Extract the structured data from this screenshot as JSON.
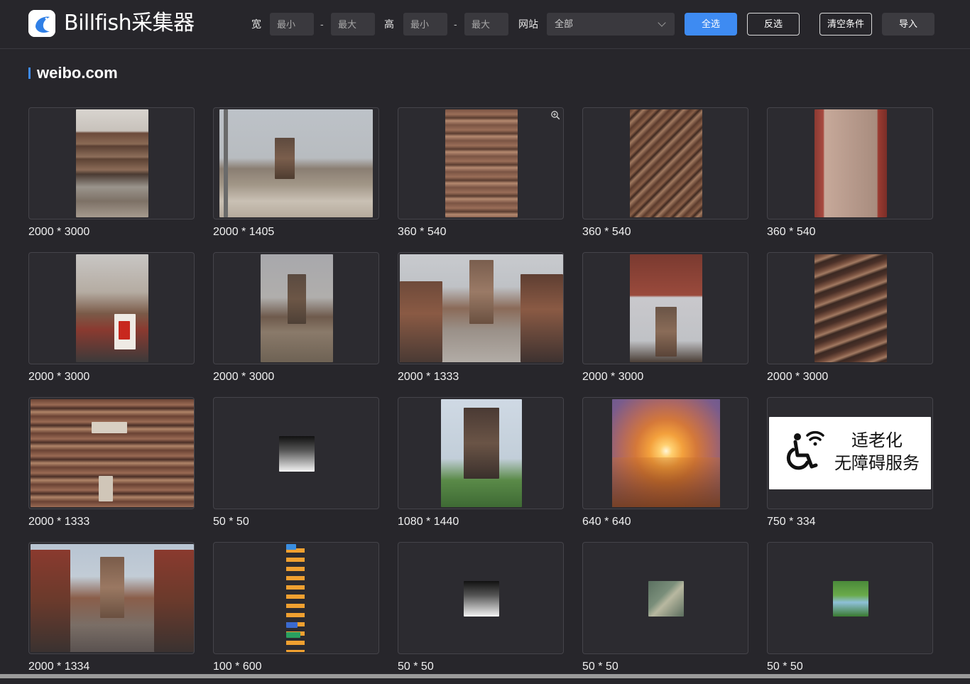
{
  "app": {
    "title": "Billfish采集器"
  },
  "filters": {
    "width_label": "宽",
    "height_label": "高",
    "site_label": "网站",
    "dash": "-",
    "min_placeholder": "最小",
    "max_placeholder": "最大",
    "site_value": "全部"
  },
  "buttons": {
    "select_all": "全选",
    "invert": "反选",
    "clear": "清空条件",
    "import": "导入"
  },
  "section": {
    "title": "weibo.com"
  },
  "icons": {
    "logo": "billfish-fish-icon",
    "zoom": "zoom-in-icon",
    "dropdown": "chevron-down-icon"
  },
  "accent_color": "#3e8bf2",
  "images": [
    {
      "dims": "2000 * 3000",
      "desc": "pagoda-ruins-portrait"
    },
    {
      "dims": "2000 * 1405",
      "desc": "pagoda-power-lines-landscape"
    },
    {
      "dims": "360 * 540",
      "desc": "pagoda-eaves-portrait"
    },
    {
      "dims": "360 * 540",
      "desc": "bracket-detail-portrait"
    },
    {
      "dims": "360 * 540",
      "desc": "mural-doorway-portrait"
    },
    {
      "dims": "2000 * 3000",
      "desc": "street-vendor-pagoda"
    },
    {
      "dims": "2000 * 3000",
      "desc": "dirt-road-pagoda"
    },
    {
      "dims": "2000 * 1333",
      "desc": "old-street-pagoda-landscape"
    },
    {
      "dims": "2000 * 3000",
      "desc": "gate-framed-pagoda"
    },
    {
      "dims": "2000 * 3000",
      "desc": "pagoda-tiers-detail"
    },
    {
      "dims": "2000 * 1333",
      "desc": "pagoda-plaques-landscape"
    },
    {
      "dims": "50 * 50",
      "desc": "tiny-gradient-icon"
    },
    {
      "dims": "1080 * 1440",
      "desc": "pagoda-trees-sky"
    },
    {
      "dims": "640 * 640",
      "desc": "sunrise-clouds"
    },
    {
      "dims": "750 * 334",
      "desc": "accessibility-banner"
    },
    {
      "dims": "2000 * 1334",
      "desc": "crowded-street-pagoda"
    },
    {
      "dims": "100 * 600",
      "desc": "vertical-tag-strip"
    },
    {
      "dims": "50 * 50",
      "desc": "tiny-gradient-icon-2"
    },
    {
      "dims": "50 * 50",
      "desc": "tiny-bird-image"
    },
    {
      "dims": "50 * 50",
      "desc": "tiny-person-image"
    }
  ],
  "banner": {
    "line1": "适老化",
    "line2": "无障碍服务"
  }
}
